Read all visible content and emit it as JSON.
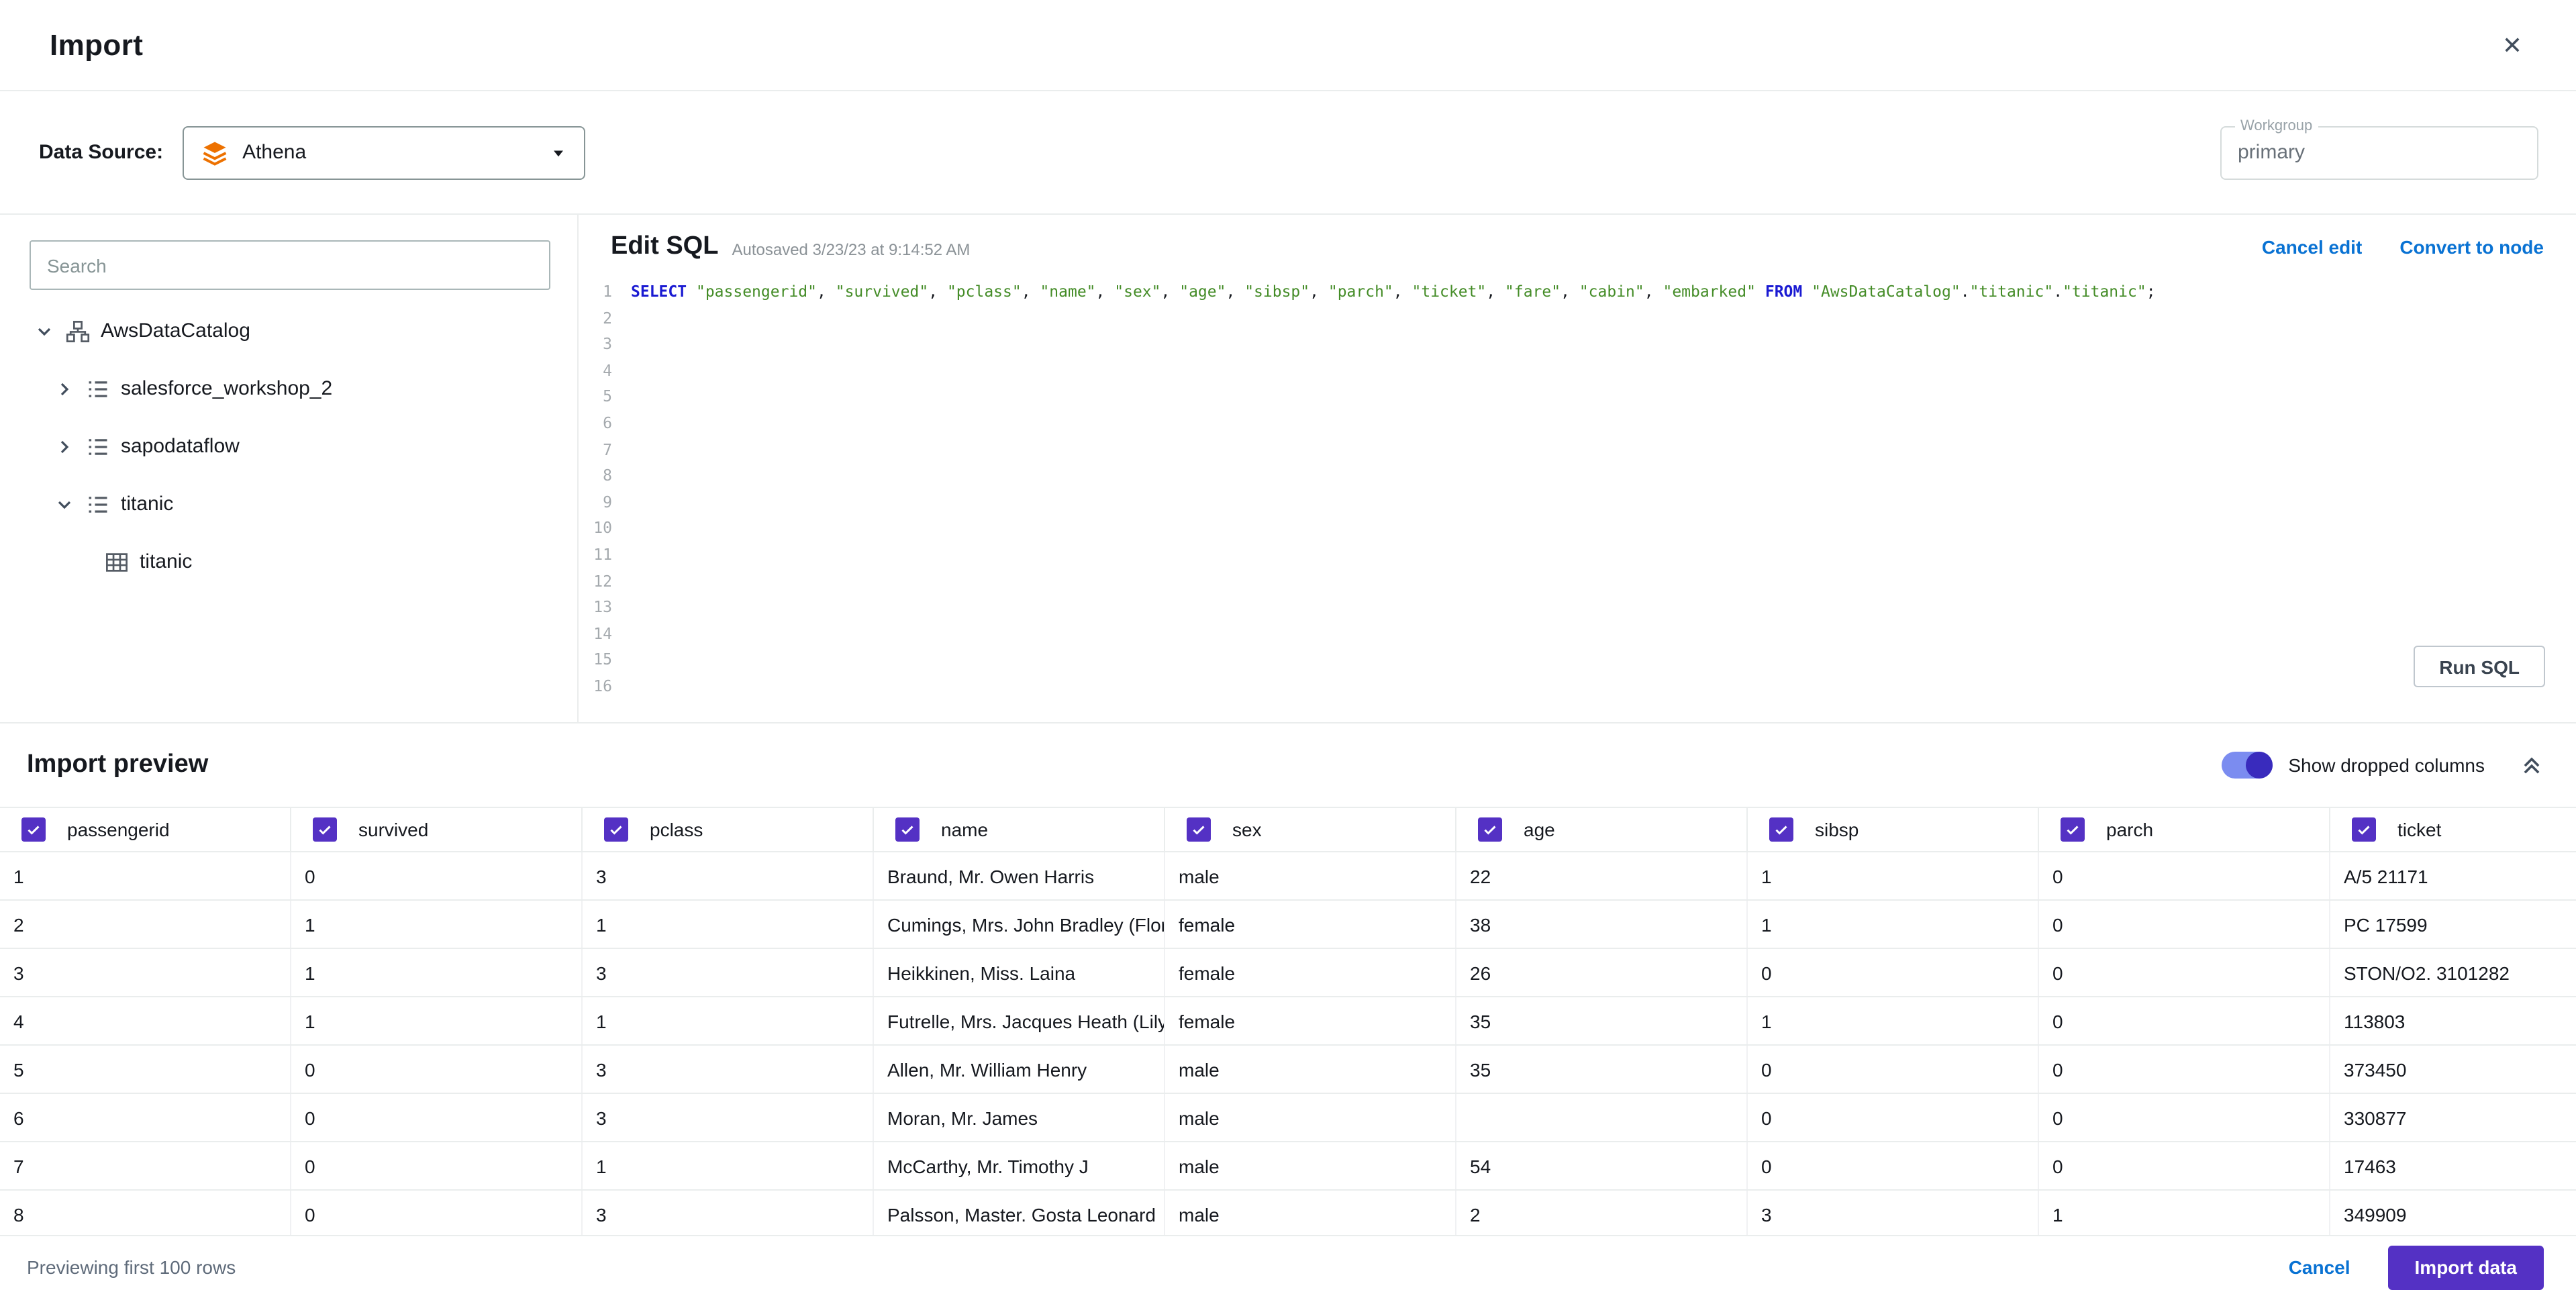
{
  "header": {
    "title": "Import",
    "close_icon": "✕"
  },
  "datasource": {
    "label": "Data Source:",
    "selected": "Athena",
    "workgroup_label": "Workgroup",
    "workgroup_value": "primary"
  },
  "sidebar": {
    "search_placeholder": "Search",
    "tree": [
      {
        "label": "AwsDataCatalog",
        "level": 0,
        "state": "expanded",
        "icon": "catalog-icon"
      },
      {
        "label": "salesforce_workshop_2",
        "level": 1,
        "state": "collapsed",
        "icon": "database-icon"
      },
      {
        "label": "sapodataflow",
        "level": 1,
        "state": "collapsed",
        "icon": "database-icon"
      },
      {
        "label": "titanic",
        "level": 1,
        "state": "expanded",
        "icon": "database-icon"
      },
      {
        "label": "titanic",
        "level": 2,
        "state": "leaf",
        "icon": "table-icon"
      }
    ]
  },
  "editor": {
    "title": "Edit SQL",
    "autosaved": "Autosaved 3/23/23 at 9:14:52 AM",
    "cancel_edit": "Cancel edit",
    "convert_to_node": "Convert to node",
    "run_sql": "Run SQL",
    "line_count": 16,
    "sql_tokens": [
      {
        "t": "kw",
        "v": "SELECT"
      },
      {
        "t": "p",
        "v": " "
      },
      {
        "t": "s",
        "v": "\"passengerid\""
      },
      {
        "t": "p",
        "v": ", "
      },
      {
        "t": "s",
        "v": "\"survived\""
      },
      {
        "t": "p",
        "v": ", "
      },
      {
        "t": "s",
        "v": "\"pclass\""
      },
      {
        "t": "p",
        "v": ", "
      },
      {
        "t": "s",
        "v": "\"name\""
      },
      {
        "t": "p",
        "v": ", "
      },
      {
        "t": "s",
        "v": "\"sex\""
      },
      {
        "t": "p",
        "v": ", "
      },
      {
        "t": "s",
        "v": "\"age\""
      },
      {
        "t": "p",
        "v": ", "
      },
      {
        "t": "s",
        "v": "\"sibsp\""
      },
      {
        "t": "p",
        "v": ", "
      },
      {
        "t": "s",
        "v": "\"parch\""
      },
      {
        "t": "p",
        "v": ", "
      },
      {
        "t": "s",
        "v": "\"ticket\""
      },
      {
        "t": "p",
        "v": ", "
      },
      {
        "t": "s",
        "v": "\"fare\""
      },
      {
        "t": "p",
        "v": ", "
      },
      {
        "t": "s",
        "v": "\"cabin\""
      },
      {
        "t": "p",
        "v": ", "
      },
      {
        "t": "s",
        "v": "\"embarked\""
      },
      {
        "t": "p",
        "v": " "
      },
      {
        "t": "kw",
        "v": "FROM"
      },
      {
        "t": "p",
        "v": " "
      },
      {
        "t": "s",
        "v": "\"AwsDataCatalog\""
      },
      {
        "t": "p",
        "v": "."
      },
      {
        "t": "s",
        "v": "\"titanic\""
      },
      {
        "t": "p",
        "v": "."
      },
      {
        "t": "s",
        "v": "\"titanic\""
      },
      {
        "t": "p",
        "v": ";"
      }
    ]
  },
  "preview": {
    "title": "Import preview",
    "toggle_label": "Show dropped columns",
    "columns": [
      "passengerid",
      "survived",
      "pclass",
      "name",
      "sex",
      "age",
      "sibsp",
      "parch",
      "ticket"
    ],
    "rows": [
      [
        "1",
        "0",
        "3",
        "Braund, Mr. Owen Harris",
        "male",
        "22",
        "1",
        "0",
        "A/5 21171"
      ],
      [
        "2",
        "1",
        "1",
        "Cumings, Mrs. John Bradley (Florenc",
        "female",
        "38",
        "1",
        "0",
        "PC 17599"
      ],
      [
        "3",
        "1",
        "3",
        "Heikkinen, Miss. Laina",
        "female",
        "26",
        "0",
        "0",
        "STON/O2. 3101282"
      ],
      [
        "4",
        "1",
        "1",
        "Futrelle, Mrs. Jacques Heath (Lily Ma",
        "female",
        "35",
        "1",
        "0",
        "113803"
      ],
      [
        "5",
        "0",
        "3",
        "Allen, Mr. William Henry",
        "male",
        "35",
        "0",
        "0",
        "373450"
      ],
      [
        "6",
        "0",
        "3",
        "Moran, Mr. James",
        "male",
        "",
        "0",
        "0",
        "330877"
      ],
      [
        "7",
        "0",
        "1",
        "McCarthy, Mr. Timothy J",
        "male",
        "54",
        "0",
        "0",
        "17463"
      ],
      [
        "8",
        "0",
        "3",
        "Palsson, Master. Gosta Leonard",
        "male",
        "2",
        "3",
        "1",
        "349909"
      ]
    ]
  },
  "footer": {
    "status": "Previewing first 100 rows",
    "cancel": "Cancel",
    "import": "Import data"
  },
  "colors": {
    "accent": "#5431c4",
    "link": "#0972d3",
    "sql_keyword": "#1a1ad2",
    "sql_string": "#448c27",
    "toggle_track": "#7b8cf0",
    "toggle_knob": "#392bbd",
    "athena_orange": "#ED7100"
  }
}
